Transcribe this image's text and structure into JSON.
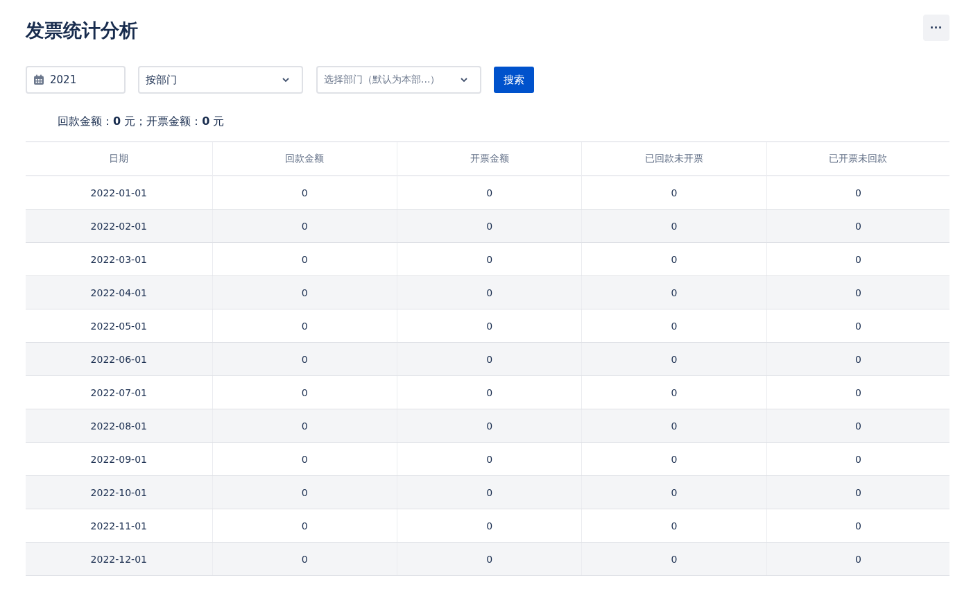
{
  "title": "发票统计分析",
  "more_button": "···",
  "filters": {
    "year": "2021",
    "group_by": "按部门",
    "department": {
      "placeholder": "选择部门（默认为本部...）"
    },
    "search_button": "搜索"
  },
  "summary": "回款金额：**0** 元；开票金额：**0** 元",
  "table": {
    "columns": [
      "日期",
      "回款金额",
      "开票金额",
      "已回款未开票",
      "已开票未回款"
    ],
    "rows": [
      [
        "2022-01-01",
        "0",
        "0",
        "0",
        "0"
      ],
      [
        "2022-02-01",
        "0",
        "0",
        "0",
        "0"
      ],
      [
        "2022-03-01",
        "0",
        "0",
        "0",
        "0"
      ],
      [
        "2022-04-01",
        "0",
        "0",
        "0",
        "0"
      ],
      [
        "2022-05-01",
        "0",
        "0",
        "0",
        "0"
      ],
      [
        "2022-06-01",
        "0",
        "0",
        "0",
        "0"
      ],
      [
        "2022-07-01",
        "0",
        "0",
        "0",
        "0"
      ],
      [
        "2022-08-01",
        "0",
        "0",
        "0",
        "0"
      ],
      [
        "2022-09-01",
        "0",
        "0",
        "0",
        "0"
      ],
      [
        "2022-10-01",
        "0",
        "0",
        "0",
        "0"
      ],
      [
        "2022-11-01",
        "0",
        "0",
        "0",
        "0"
      ],
      [
        "2022-12-01",
        "0",
        "0",
        "0",
        "0"
      ]
    ]
  }
}
